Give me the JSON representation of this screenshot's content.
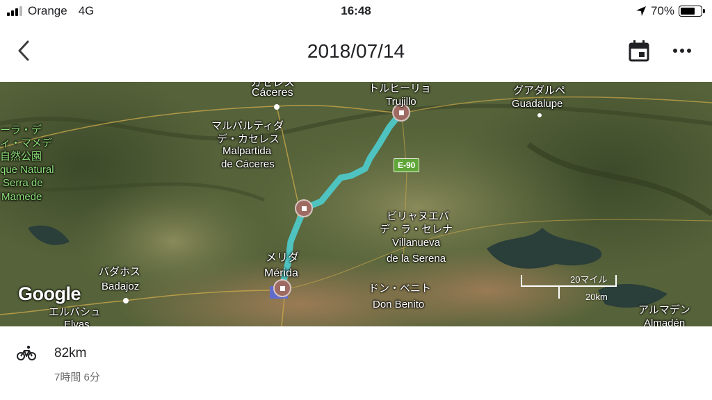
{
  "status_bar": {
    "carrier": "Orange",
    "network": "4G",
    "time": "16:48",
    "battery": "70%",
    "battery_level": 0.7
  },
  "app_bar": {
    "title": "2018/07/14",
    "icons": [
      "back-chevron-icon",
      "calendar-icon",
      "more-horizontal-icon"
    ]
  },
  "map": {
    "labels": {
      "caceres_ja": "カセレス",
      "caceres": "Cáceres",
      "trujillo_ja": "トルヒーリョ",
      "trujillo": "Trujillo",
      "guadalupe_ja": "グアダルペ",
      "guadalupe": "Guadalupe",
      "park_ja_1": "ーラ・デ",
      "park_ja_2": "ィ・マメデ",
      "park_ja_3": "自然公園",
      "park_1": "que Natural",
      "park_2": "Serra de",
      "park_3": "Mamede",
      "malpartida_ja_1": "マルパルティダ",
      "malpartida_ja_2": "デ・カセレス",
      "malpartida_1": "Malpartida",
      "malpartida_2": "de Cáceres",
      "road": "E-90",
      "villanueva_ja_1": "ビリャヌエバ",
      "villanueva_ja_2": "デ・ラ・セレナ",
      "villanueva_1": "Villanueva",
      "villanueva_2": "de la Serena",
      "merida_ja": "メリダ",
      "merida": "Mérida",
      "badajoz_ja": "バダホス",
      "badajoz": "Badajoz",
      "elvas_ja": "エルバシュ",
      "elvas": "Elvas",
      "donbenito_ja": "ドン・ベニト",
      "donbenito": "Don Benito",
      "almaden_ja": "アルマデン",
      "almaden": "Almadén"
    },
    "google_logo": "Google",
    "scale_miles": "20マイル",
    "scale_km": "20km",
    "route_color": "#4fc3c0",
    "marker_color": "#9e6b63"
  },
  "activity": {
    "icon": "bicycle-icon",
    "distance": "82km",
    "duration": "7時間 6分"
  }
}
